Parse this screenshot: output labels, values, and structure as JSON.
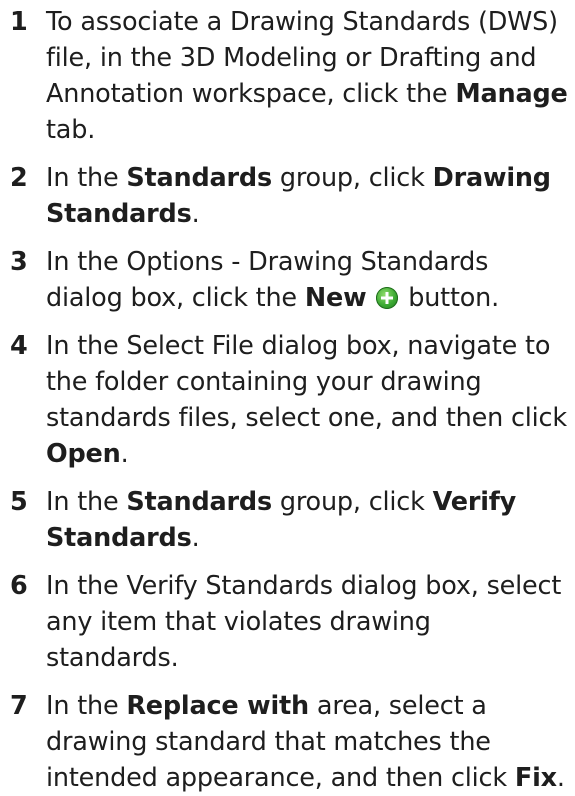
{
  "steps": [
    {
      "number": "1",
      "parts": [
        "To associate a Drawing Standards (DWS) file, in the 3D Modeling or Drafting and Annotation workspace, click the ",
        "Manage",
        " tab."
      ]
    },
    {
      "number": "2",
      "parts": [
        "In the ",
        "Standards",
        " group, click ",
        "Drawing Standards",
        "."
      ]
    },
    {
      "number": "3",
      "parts": [
        "In the Options - Drawing Standards dialog box, click the ",
        "New",
        " button."
      ],
      "icon": "green-plus-icon"
    },
    {
      "number": "4",
      "parts": [
        "In the Select File dialog box, navigate to the folder containing your drawing standards files, select one, and then click ",
        "Open",
        "."
      ]
    },
    {
      "number": "5",
      "parts": [
        "In the ",
        "Standards",
        " group, click ",
        "Verify Standards",
        "."
      ]
    },
    {
      "number": "6",
      "parts": [
        "In the Verify Standards dialog box, select any item that violates drawing standards."
      ]
    },
    {
      "number": "7",
      "parts": [
        "In the ",
        "Replace with",
        " area, select a drawing standard that matches the intended appearance, and then click ",
        "Fix",
        "."
      ]
    }
  ]
}
